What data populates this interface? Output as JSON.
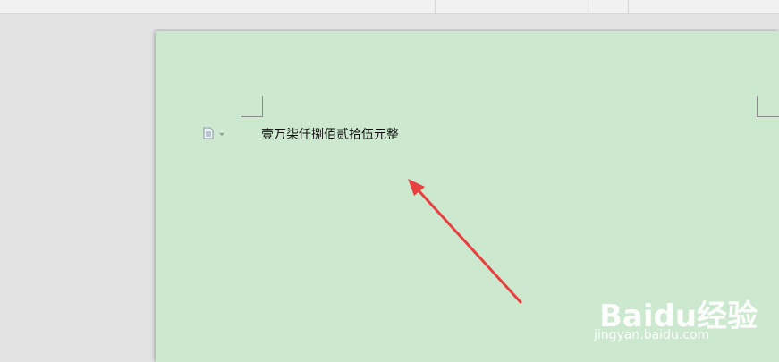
{
  "document": {
    "body_text": "壹万柒仟捌佰贰拾伍元整"
  },
  "icons": {
    "paragraph_handle": "document-icon"
  },
  "annotation": {
    "arrow_color": "#e8403f"
  },
  "watermark": {
    "brand": "Baidu经验",
    "url": "jingyan.baidu.com"
  },
  "colors": {
    "page_background": "#cce8cf",
    "workspace_background": "#e3e3e3"
  }
}
